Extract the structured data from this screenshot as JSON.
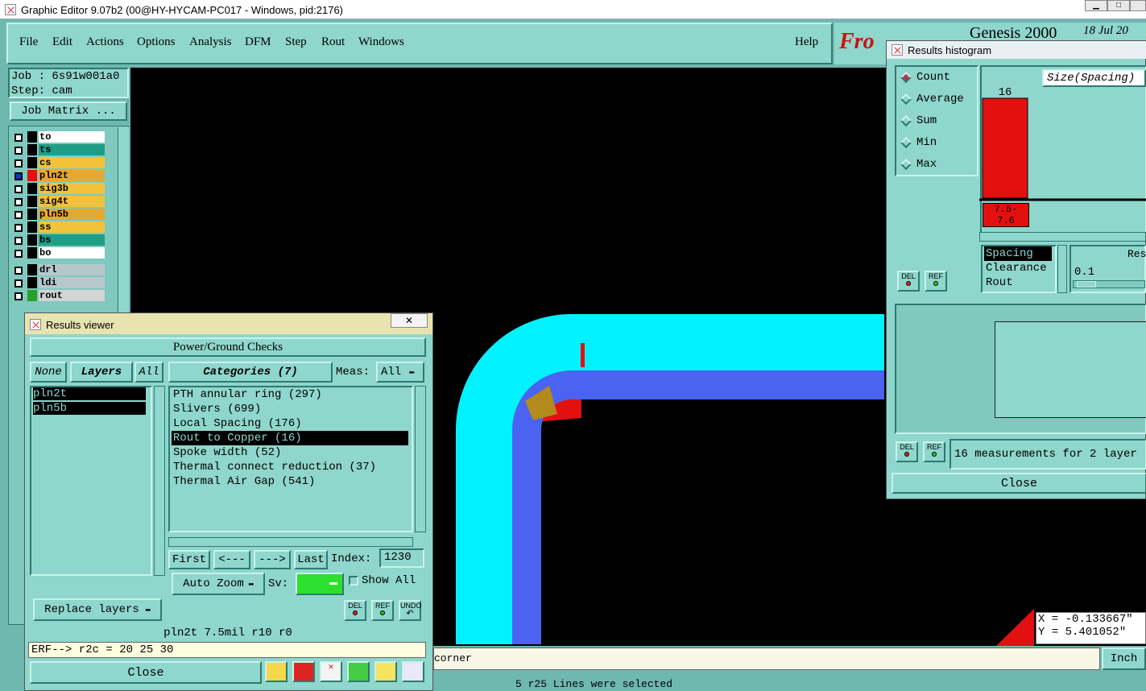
{
  "window": {
    "title": "Graphic Editor 9.07b2 (00@HY-HYCAM-PC017 - Windows, pid:2176)"
  },
  "menu": {
    "items": [
      "File",
      "Edit",
      "Actions",
      "Options",
      "Analysis",
      "DFM",
      "Step",
      "Rout",
      "Windows"
    ],
    "help": "Help"
  },
  "brand": {
    "logo_text": "Fro",
    "product": "Genesis 2000",
    "date": "18 Jul 20"
  },
  "job": {
    "job_label": "Job : 6s91w001a0",
    "step_label": "Step: cam",
    "matrix_button": "Job Matrix ..."
  },
  "layers": [
    {
      "name": "to",
      "color": "#ffffff"
    },
    {
      "name": "ts",
      "color": "#1f9e84"
    },
    {
      "name": "cs",
      "color": "#f2c23a"
    },
    {
      "name": "pln2t",
      "color": "#e3a935"
    },
    {
      "name": "sig3b",
      "color": "#f2c23a"
    },
    {
      "name": "sig4t",
      "color": "#f2c23a"
    },
    {
      "name": "pln5b",
      "color": "#e3a935"
    },
    {
      "name": "ss",
      "color": "#f2c23a"
    },
    {
      "name": "bs",
      "color": "#1f9e84"
    },
    {
      "name": "bo",
      "color": "#ffffff"
    },
    {
      "name": "drl",
      "color": "#b6c8cc"
    },
    {
      "name": "ldi",
      "color": "#b6c8cc"
    },
    {
      "name": "rout",
      "color": "#d4d4d4"
    }
  ],
  "results_viewer": {
    "title": "Results viewer",
    "header": "Power/Ground Checks",
    "none_btn": "None",
    "layers_btn": "Layers",
    "all_btn": "All",
    "categories_btn": "Categories (7)",
    "meas_label": "Meas:",
    "meas_value": "All",
    "layer_list": [
      "pln2t",
      "pln5b"
    ],
    "categories": [
      "PTH annular ring (297)",
      "Slivers (699)",
      "Local Spacing (176)",
      "Rout to Copper (16)",
      "Spoke width (52)",
      "Thermal connect reduction (37)",
      "Thermal Air Gap (541)"
    ],
    "selected_category": "Rout to Copper (16)",
    "first": "First",
    "prev": "<---",
    "next": "--->",
    "last": "Last",
    "index_label": "Index:",
    "index_value": "1230",
    "auto_zoom": "Auto Zoom",
    "sv_label": "Sv:",
    "show_all": "Show All",
    "replace_layers": "Replace layers",
    "status_line": "pln2t 7.5mil  r10  r0",
    "erf_line": "ERF--> r2c = 20 25 30",
    "close": "Close",
    "del": "DEL",
    "ref": "REF",
    "undo": "UNDO"
  },
  "histogram": {
    "title": "Results histogram",
    "modes": [
      "Count",
      "Average",
      "Sum",
      "Min",
      "Max"
    ],
    "selected_mode": "Count",
    "size_dropdown": "Size(Spacing)",
    "bar_count": "16",
    "bar_label": "7.5- 7.6",
    "types": [
      "Spacing",
      "Clearance",
      "Rout"
    ],
    "selected_type": "Spacing",
    "res_label": "Res",
    "res_value": "0.1",
    "measurements": "16 measurements for 2 layer",
    "close": "Close",
    "del": "DEL",
    "ref": "REF"
  },
  "chart_data": {
    "type": "bar",
    "categories": [
      "7.5- 7.6"
    ],
    "values": [
      16
    ],
    "xlabel": "Size(Spacing)"
  },
  "status": {
    "message_fragment": "corner",
    "units": "Inch",
    "selection": "5 r25 Lines were selected",
    "x_readout": "X = -0.133667\"",
    "y_readout": "Y = 5.401052\""
  }
}
